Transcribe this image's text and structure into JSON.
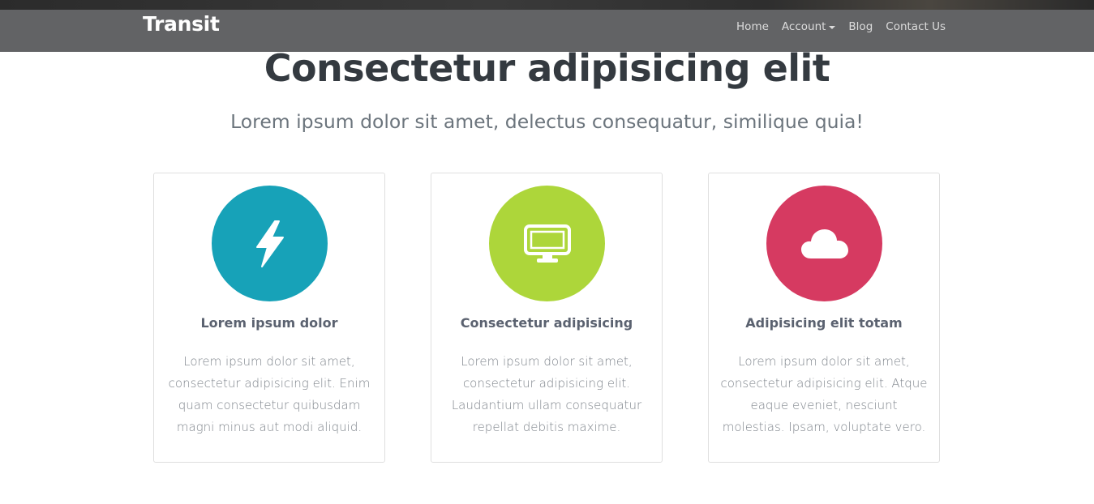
{
  "navbar": {
    "brand": "Transit",
    "links": [
      {
        "label": "Home"
      },
      {
        "label": "Account"
      },
      {
        "label": "Blog"
      },
      {
        "label": "Contact Us"
      }
    ]
  },
  "hero": {
    "title": "Consectetur adipisicing elit",
    "subtitle": "Lorem ipsum dolor sit amet, delectus consequatur, similique quia!"
  },
  "cards": [
    {
      "icon": "lightning-bolt-icon",
      "color": "#17a2b8",
      "title": "Lorem ipsum dolor",
      "text": "Lorem ipsum dolor sit amet, consectetur adipisicing elit. Enim quam consectetur quibusdam magni minus aut modi aliquid."
    },
    {
      "icon": "desktop-monitor-icon",
      "color": "#add63a",
      "title": "Consectetur adipisicing",
      "text": "Lorem ipsum dolor sit amet, consectetur adipisicing elit. Laudantium ullam consequatur repellat debitis maxime."
    },
    {
      "icon": "cloud-icon",
      "color": "#d63a61",
      "title": "Adipisicing elit totam",
      "text": "Lorem ipsum dolor sit amet, consectetur adipisicing elit. Atque eaque eveniet, nesciunt molestias. Ipsam, voluptate vero."
    }
  ]
}
